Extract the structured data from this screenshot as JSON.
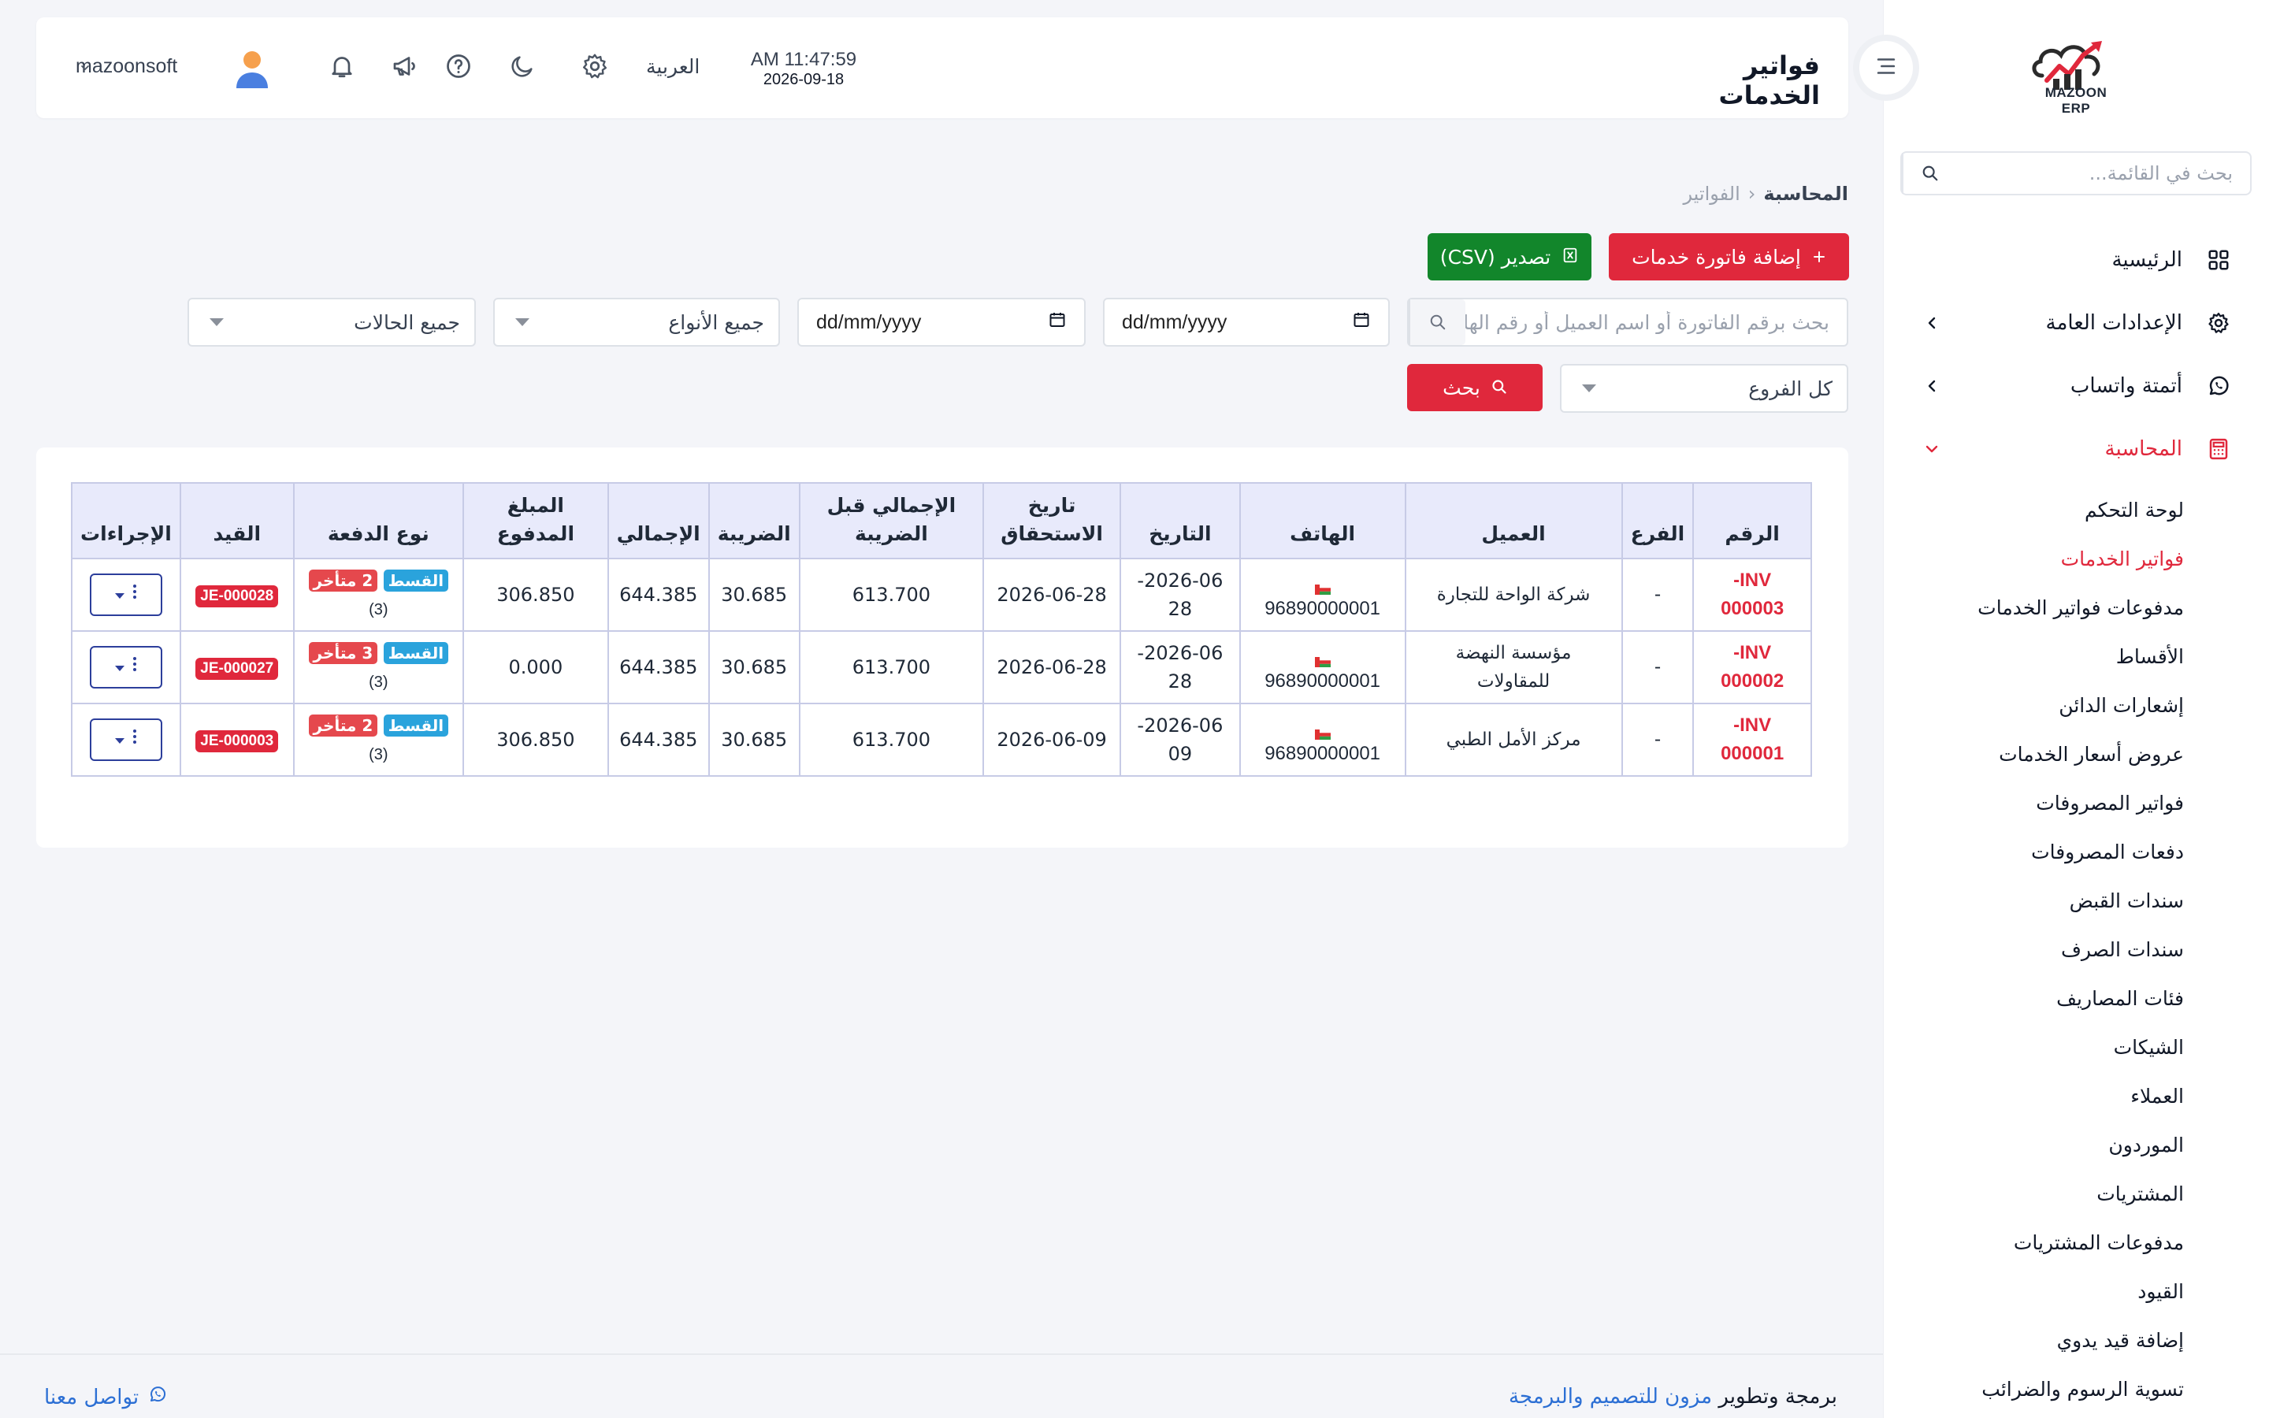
{
  "app": {
    "logo_text": "MAZOON ERP",
    "brand_color": "#e0283c"
  },
  "sidebar": {
    "search_placeholder": "بحث في القائمة...",
    "items": [
      {
        "label": "الرئيسية",
        "icon": "grid-icon"
      },
      {
        "label": "الإعدادات العامة",
        "icon": "gear-icon"
      },
      {
        "label": "أتمتة واتساب",
        "icon": "whatsapp-icon"
      },
      {
        "label": "المحاسبة",
        "icon": "calculator-icon"
      }
    ],
    "subitems": [
      "لوحة التحكم",
      "فواتير الخدمات",
      "مدفوعات فواتير الخدمات",
      "الأقساط",
      "إشعارات الدائن",
      "عروض أسعار الخدمات",
      "فواتير المصروفات",
      "دفعات المصروفات",
      "سندات القبض",
      "سندات الصرف",
      "فئات المصاريف",
      "الشيكات",
      "العملاء",
      "الموردون",
      "المشتريات",
      "مدفوعات المشتريات",
      "القيود",
      "إضافة قيد يدوي",
      "تسوية الرسوم والضرائب"
    ]
  },
  "header": {
    "title": "فواتير الخدمات",
    "time": "AM 11:47:59",
    "date": "2026-09-18",
    "language": "العربية",
    "username": "mazoonsoft"
  },
  "breadcrumb": {
    "parent": "المحاسبة",
    "current": "الفواتير"
  },
  "actions": {
    "add_label": "إضافة فاتورة خدمات",
    "export_label": "تصدير (CSV)",
    "search_label": "بحث"
  },
  "filters": {
    "search_placeholder": "بحث برقم الفاتورة أو اسم العميل أو رقم الهاتف",
    "date_from": "dd/mm/yyyy",
    "date_to": "dd/mm/yyyy",
    "types": "جميع الأنواع",
    "statuses": "جميع الحالات",
    "branches": "كل الفروع"
  },
  "table": {
    "headers": {
      "number": "الرقم",
      "branch": "الفرع",
      "customer": "العميل",
      "phone": "الهاتف",
      "date": "التاريخ",
      "due_1": "تاريخ",
      "due_2": "الاستحقاق",
      "pretax_1": "الإجمالي قبل",
      "pretax_2": "الضريبة",
      "tax": "الضريبة",
      "total": "الإجمالي",
      "paid_1": "المبلغ",
      "paid_2": "المدفوع",
      "paytype": "نوع الدفعة",
      "entry": "القيد",
      "actions": "الإجراءات"
    },
    "rows": [
      {
        "number_1": "INV-",
        "number_2": "000003",
        "branch": "-",
        "customer": "شركة الواحة للتجارة",
        "customer_2": "",
        "phone": "96890000001",
        "date_1": "2026-06-",
        "date_2": "28",
        "due": "2026-06-28",
        "pretax": "613.700",
        "tax": "30.685",
        "total": "644.385",
        "paid": "306.850",
        "badge_inst": "القسط",
        "badge_late": "2 متأخر",
        "pay_count": "(3)",
        "entry": "JE-000028"
      },
      {
        "number_1": "INV-",
        "number_2": "000002",
        "branch": "-",
        "customer": "مؤسسة النهضة",
        "customer_2": "للمقاولات",
        "phone": "96890000001",
        "date_1": "2026-06-",
        "date_2": "28",
        "due": "2026-06-28",
        "pretax": "613.700",
        "tax": "30.685",
        "total": "644.385",
        "paid": "0.000",
        "badge_inst": "القسط",
        "badge_late": "3 متأخر",
        "pay_count": "(3)",
        "entry": "JE-000027"
      },
      {
        "number_1": "INV-",
        "number_2": "000001",
        "branch": "-",
        "customer": "مركز الأمل الطبي",
        "customer_2": "",
        "phone": "96890000001",
        "date_1": "2026-06-",
        "date_2": "09",
        "due": "2026-06-09",
        "pretax": "613.700",
        "tax": "30.685",
        "total": "644.385",
        "paid": "306.850",
        "badge_inst": "القسط",
        "badge_late": "2 متأخر",
        "pay_count": "(3)",
        "entry": "JE-000003"
      }
    ]
  },
  "footer": {
    "credit_prefix": "برمجة وتطوير",
    "credit_link": "مزون للتصميم والبرمجة",
    "contact": "تواصل معنا"
  }
}
